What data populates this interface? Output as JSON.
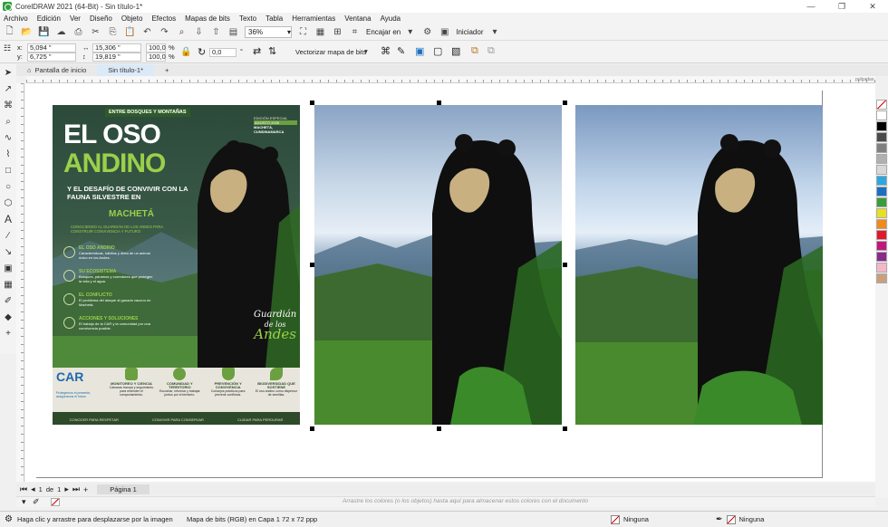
{
  "window": {
    "title": "CorelDRAW 2021 (64-Bit) - Sin título-1*",
    "controls": [
      "—",
      "❐",
      "✕"
    ]
  },
  "menu": [
    "Archivo",
    "Edición",
    "Ver",
    "Diseño",
    "Objeto",
    "Efectos",
    "Mapas de bits",
    "Texto",
    "Tabla",
    "Herramientas",
    "Ventana",
    "Ayuda"
  ],
  "toolbar": {
    "zoom": "36%",
    "snap_label": "Encajar en",
    "launcher_label": "Iniciador"
  },
  "props": {
    "x": "5,094 \"",
    "y": "6,725 \"",
    "width": "15,306 \"",
    "height": "19,819 \"",
    "scale_w": "100,0",
    "scale_h": "100,0",
    "scale_unit": "%",
    "angle": "0,0",
    "trace_label": "Vectorizar mapa de bits"
  },
  "tabs": {
    "home": "Pantalla de inicio",
    "doc": "Sin título-1*",
    "add": "+"
  },
  "ruler": {
    "unit": "pulgadas"
  },
  "poster": {
    "badge": "ENTRE BOSQUES Y MONTAÑAS",
    "edition": "EDICIÓN ESPECIAL",
    "date": "AGOSTO 2026",
    "location": "MACHETÁ, CUNDINAMARCA",
    "title_line1": "EL OSO",
    "title_line2": "ANDINO",
    "subtitle": "Y EL DESAFÍO DE CONVIVIR CON LA FAUNA SILVESTRE EN",
    "subtitle_place": "MACHETÁ",
    "tagline": "CONOCIENDO AL GUARDIÁN DE LOS ANDES PARA CONSTRUIR CONVIVENCIA Y FUTURO",
    "sections": [
      {
        "head": "EL OSO ANDINO",
        "body": "Características, hábitos y dieta de un animal único en los Andes."
      },
      {
        "head": "SU ECOSISTEMA",
        "body": "Bosques, páramos y corredores que protegen la vida y el agua."
      },
      {
        "head": "EL CONFLICTO",
        "body": "El problema del ataque al ganado vacuno en Machetá."
      },
      {
        "head": "ACCIONES Y SOLUCIONES",
        "body": "El trabajo de la CAR y la comunidad por una convivencia posible."
      }
    ],
    "script_line1": "Guardián",
    "script_line2": "de los",
    "script_line3": "Andes",
    "logo": "CAR",
    "logo_sub": "Protegemos el presente, aseguramos el futuro",
    "pillars": [
      {
        "head": "MONITOREO Y CIENCIA",
        "body": "Cámaras trampa y seguimiento para entender el comportamiento."
      },
      {
        "head": "COMUNIDAD Y TERRITORIO",
        "body": "Escuchar, informar y trabajar juntos por el territorio."
      },
      {
        "head": "PREVENCIÓN Y CONVIVENCIA",
        "body": "Consejos prácticos para prevenir conflictos."
      },
      {
        "head": "BIODIVERSIDAD QUE SOSTIENE",
        "body": "El oso andino como dispersor de semillas."
      }
    ],
    "footer": [
      "CONOCER PARA RESPETAR",
      "CONVIVIR PARA CONSERVAR",
      "CUIDAR PARA PERDURAR"
    ]
  },
  "pagebar": {
    "current": "1",
    "of_label": "de",
    "total": "1",
    "page_tab": "Página 1"
  },
  "colorbar": {
    "hint": "Arrastre los colores (o los objetos) hasta aquí para almacenar estos colores con el documento"
  },
  "status": {
    "hint": "Haga clic y arrastre para desplazarse por la imagen",
    "info": "Mapa de bits (RGB) en Capa 1 72 x 72 ppp",
    "fill": "Ninguna",
    "outline": "Ninguna"
  },
  "palette_colors": [
    "#ffffff",
    "#000000",
    "#4a4a4a",
    "#808080",
    "#b0b0b0",
    "#d8d8d8",
    "#2ca8e0",
    "#1a6fc1",
    "#3a9d3a",
    "#e6e020",
    "#f08a1c",
    "#e0182a",
    "#c0187a",
    "#8a2a8a",
    "#f4b8c8",
    "#c8a080"
  ]
}
